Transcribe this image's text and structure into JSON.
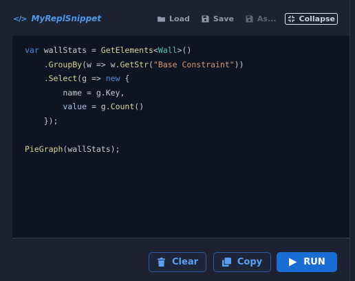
{
  "header": {
    "title": "MyReplSnippet",
    "title_icon": "</>",
    "toolbar": [
      {
        "label": "Load",
        "icon": "folder-icon"
      },
      {
        "label": "Save",
        "icon": "floppy-icon"
      },
      {
        "label": "As...",
        "icon": "floppy-icon"
      },
      {
        "label": "Collapse",
        "icon": "collapse-icon"
      }
    ]
  },
  "editor": {
    "lines": [
      "var wallStats = GetElements<Wall>()",
      "    .GroupBy(w => w.GetStr(\"Base Constraint\"))",
      "    .Select(g => new {",
      "        name = g.Key,",
      "        value = g.Count()",
      "    });",
      "",
      "PieGraph(wallStats);"
    ]
  },
  "footer": {
    "clear_label": "Clear",
    "copy_label": "Copy",
    "run_label": "RUN"
  },
  "colors": {
    "accent": "#1b6dd6",
    "title": "#4f97e8",
    "background": "#1c2232",
    "editor_bg": "#0e1422"
  }
}
